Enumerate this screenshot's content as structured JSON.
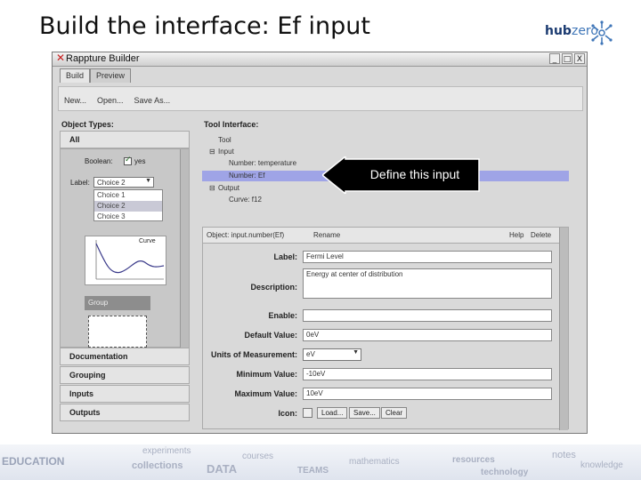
{
  "slide": {
    "title": "Build the interface:  Ef input"
  },
  "logo": {
    "hub": "hub",
    "zero": "zero"
  },
  "window": {
    "title": "Rappture Builder",
    "controls": {
      "minimize": "_",
      "maximize": "□",
      "close": "X"
    },
    "tabs": [
      {
        "label": "Build"
      },
      {
        "label": "Preview"
      }
    ],
    "toolbar": {
      "new": "New...",
      "open": "Open...",
      "save_as": "Save As..."
    }
  },
  "object_types": {
    "heading": "Object Types:",
    "categories": {
      "all": "All",
      "documentation": "Documentation",
      "grouping": "Grouping",
      "inputs": "Inputs",
      "outputs": "Outputs"
    },
    "boolean_label": "Boolean:",
    "boolean_value": "yes",
    "label_label": "Label:",
    "label_value": "Choice 2",
    "choices": [
      "Choice 1",
      "Choice 2",
      "Choice 3"
    ],
    "curve_label": "Curve",
    "group_label": "Group"
  },
  "tool_interface": {
    "heading": "Tool Interface:",
    "items": {
      "tool": "Tool",
      "input": "Input",
      "number_temperature": "Number: temperature",
      "number_ef": "Number: Ef",
      "output": "Output",
      "curve": "Curve: f12"
    }
  },
  "object": {
    "header": "Object: input.number(Ef)",
    "rename": "Rename",
    "help": "Help",
    "delete": "Delete",
    "fields": {
      "label": {
        "name": "Label:",
        "value": "Fermi Level"
      },
      "description": {
        "name": "Description:",
        "value": "Energy at center of distribution"
      },
      "enable": {
        "name": "Enable:",
        "value": ""
      },
      "default_value": {
        "name": "Default Value:",
        "value": "0eV"
      },
      "units": {
        "name": "Units of Measurement:",
        "value": "eV"
      },
      "minimum": {
        "name": "Minimum Value:",
        "value": "-10eV"
      },
      "maximum": {
        "name": "Maximum Value:",
        "value": "10eV"
      },
      "icon": {
        "name": "Icon:",
        "load": "Load...",
        "save": "Save...",
        "clear": "Clear"
      }
    }
  },
  "callout": {
    "text": "Define this input"
  },
  "footer_words": [
    "EDUCATION",
    "experiments",
    "collections",
    "courses",
    "DATA",
    "TEAMS",
    "mathematics",
    "resources",
    "notes",
    "knowledge",
    "technology"
  ],
  "colors": {
    "selection": "#9fa4e6",
    "callout": "#000000",
    "close_x": "#c81e1e"
  }
}
